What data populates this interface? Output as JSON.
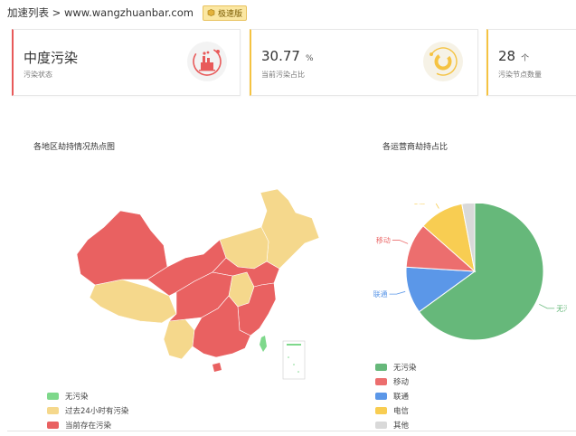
{
  "header": {
    "breadcrumb": "加速列表 > www.wangzhuanbar.com",
    "badge": "极速版"
  },
  "cards": [
    {
      "value": "中度污染",
      "unit": "",
      "label": "污染状态",
      "accent": "#e85a5a",
      "icon": "factory-pollution-icon"
    },
    {
      "value": "30.77",
      "unit": "%",
      "label": "当前污染占比",
      "accent": "#f5c342",
      "icon": "ring-percent-icon"
    },
    {
      "value": "28",
      "unit": "个",
      "label": "污染节点数量",
      "accent": "#f5c342",
      "icon": ""
    }
  ],
  "map": {
    "title": "各地区劫持情况热点图",
    "legend": [
      {
        "label": "无污染",
        "color": "#7ed88b"
      },
      {
        "label": "过去24小时有污染",
        "color": "#f5d88c"
      },
      {
        "label": "当前存在污染",
        "color": "#e96161"
      }
    ]
  },
  "pie": {
    "title": "各运营商劫持占比",
    "legend": [
      {
        "label": "无污染",
        "color": "#66b87a"
      },
      {
        "label": "移动",
        "color": "#ec6e6e"
      },
      {
        "label": "联通",
        "color": "#5b97e8"
      },
      {
        "label": "电信",
        "color": "#f8cd52"
      },
      {
        "label": "其他",
        "color": "#d9d9d9"
      }
    ]
  },
  "chart_data": {
    "type": "pie",
    "title": "各运营商劫持占比",
    "slices": [
      {
        "name": "无污染",
        "value": 65,
        "color": "#66b87a"
      },
      {
        "name": "联通",
        "value": 11,
        "color": "#5b97e8"
      },
      {
        "name": "移动",
        "value": 10.5,
        "color": "#ec6e6e"
      },
      {
        "name": "电信",
        "value": 10.5,
        "color": "#f8cd52"
      },
      {
        "name": "其他",
        "value": 3,
        "color": "#d9d9d9"
      }
    ],
    "legend_position": "bottom-left"
  }
}
